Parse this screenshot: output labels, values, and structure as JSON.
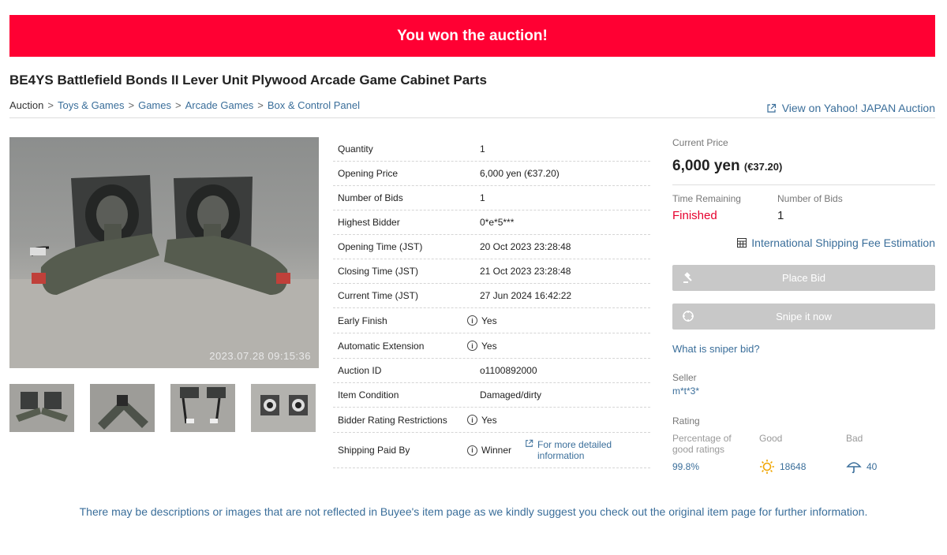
{
  "banner": {
    "text": "You won the auction!"
  },
  "item": {
    "title": "BE4YS Battlefield Bonds II Lever Unit Plywood Arcade Game Cabinet Parts"
  },
  "breadcrumb": {
    "root": "Auction",
    "items": [
      "Toys & Games",
      "Games",
      "Arcade Games",
      "Box & Control Panel"
    ]
  },
  "yahoo_link": "View on Yahoo! JAPAN Auction",
  "photo": {
    "timestamp": "2023.07.28 09:15:36"
  },
  "details": [
    {
      "label": "Quantity",
      "value": "1"
    },
    {
      "label": "Opening Price",
      "value": "6,000 yen (€37.20)"
    },
    {
      "label": "Number of Bids",
      "value": "1"
    },
    {
      "label": "Highest Bidder",
      "value": "0*e*5***"
    },
    {
      "label": "Opening Time (JST)",
      "value": "20 Oct 2023 23:28:48"
    },
    {
      "label": "Closing Time (JST)",
      "value": "21 Oct 2023 23:28:48"
    },
    {
      "label": "Current Time (JST)",
      "value": "27 Jun 2024 16:42:22"
    },
    {
      "label": "Early Finish",
      "value": "Yes"
    },
    {
      "label": "Automatic Extension",
      "value": "Yes"
    },
    {
      "label": "Auction ID",
      "value": "o1100892000"
    },
    {
      "label": "Item Condition",
      "value": "Damaged/dirty"
    },
    {
      "label": "Bidder Rating Restrictions",
      "value": "Yes"
    },
    {
      "label": "Shipping Paid By",
      "value": "Winner",
      "more": "For more detailed information"
    }
  ],
  "price": {
    "label": "Current Price",
    "value": "6,000 yen",
    "converted": "(€37.20)"
  },
  "status": {
    "time_label": "Time Remaining",
    "time_value": "Finished",
    "bids_label": "Number of Bids",
    "bids_value": "1"
  },
  "shipping_estimation": "International Shipping Fee Estimation",
  "buttons": {
    "place_bid": "Place Bid",
    "snipe": "Snipe it now"
  },
  "sniper_link": "What is sniper bid?",
  "seller": {
    "label": "Seller",
    "name": "m*t*3*"
  },
  "rating": {
    "label": "Rating",
    "pct_label": "Percentage of good ratings",
    "good_label": "Good",
    "bad_label": "Bad",
    "pct_value": "99.8%",
    "good_value": "18648",
    "bad_value": "40"
  },
  "notice": "There may be descriptions or images that are not reflected in Buyee's item page as we kindly suggest you check out the original item page for further information.",
  "colors": {
    "banner": "#ff0033",
    "link": "#3a6e9a",
    "finished": "#e6002d",
    "button_disabled": "#c8c8c8"
  }
}
